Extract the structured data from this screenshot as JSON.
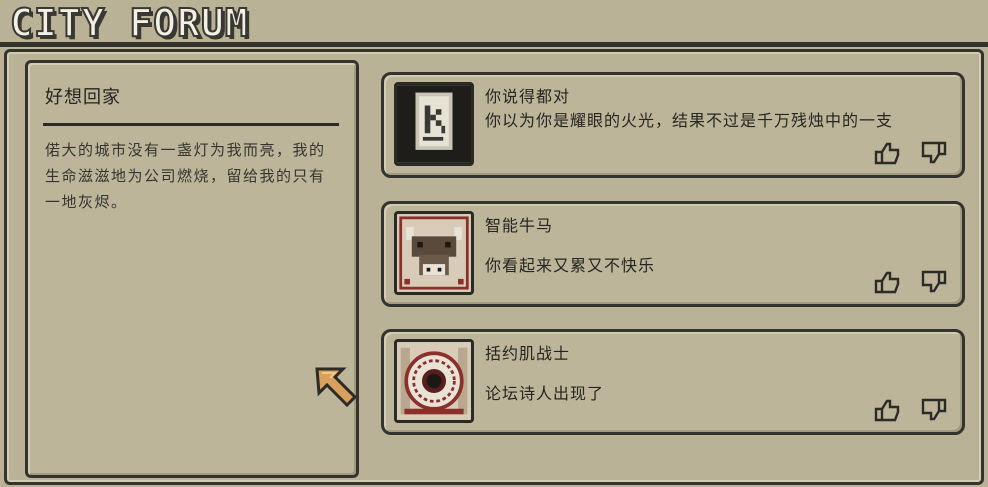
{
  "header": {
    "title": "CITY FORUM"
  },
  "post": {
    "title": "好想回家",
    "body": "偌大的城市没有一盏灯为我而亮，我的生命滋滋地为公司燃烧，留给我的只有一地灰烬。"
  },
  "comments": [
    {
      "author": "你说得都对",
      "text": "你以为你是耀眼的火光，结果不过是千万残烛中的一支",
      "avatar_icon": "k-card-icon"
    },
    {
      "author": "智能牛马",
      "text": "你看起来又累又不快乐",
      "avatar_icon": "cow-icon"
    },
    {
      "author": "括约肌战士",
      "text": "论坛诗人出现了",
      "avatar_icon": "eye-target-icon"
    }
  ],
  "icons": {
    "like": "thumbs-up-icon",
    "dislike": "thumbs-down-icon",
    "cursor": "pointer-arrow-icon"
  },
  "colors": {
    "background": "#b9b297",
    "outline": "#35332e",
    "accent_red": "#8a2f2a",
    "cursor_orange": "#d9a05b"
  }
}
